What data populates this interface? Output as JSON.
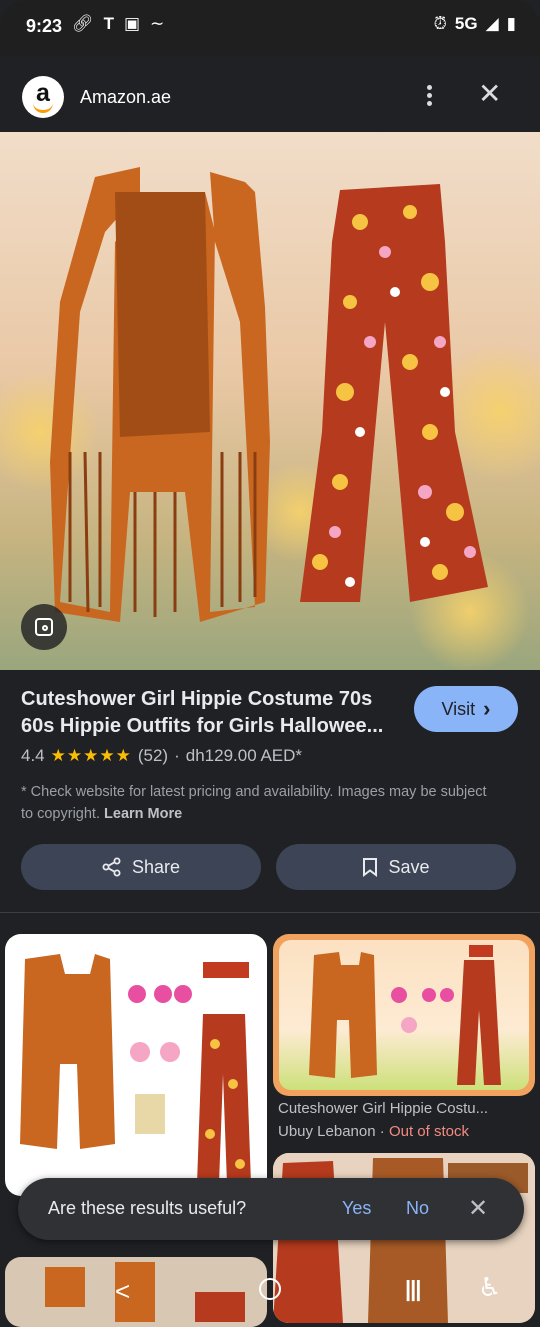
{
  "status_bar": {
    "time": "9:23",
    "network": "5G",
    "left_icons": [
      "link-icon",
      "tmobile-icon",
      "message-icon",
      "signature-icon"
    ],
    "right_icons": [
      "alarm-icon",
      "signal-icon",
      "battery-icon"
    ]
  },
  "header": {
    "site_name": "Amazon.ae",
    "logo_letter": "a",
    "menu_icon": "more-vert-icon",
    "close_icon": "close-icon",
    "close_glyph": "✕"
  },
  "product": {
    "title": "Cuteshower Girl Hippie Costume 70s 60s Hippie Outfits for Girls Halloween...",
    "title_line1": "Cuteshower Girl Hippie Costume 70s",
    "title_line2": "60s Hippie Outfits for Girls Hallowee...",
    "rating": "4.4",
    "rating_value": 4.4,
    "stars": "★★★★★",
    "review_count": "(52)",
    "separator": "·",
    "price": "dh129.00 AED*",
    "visit_label": "Visit",
    "visit_chevron": "›",
    "disclaimer": "* Check website for latest pricing and availability. Images may be subject to copyright.",
    "learn_more": "Learn More"
  },
  "actions": {
    "share_label": "Share",
    "save_label": "Save"
  },
  "related": [
    {
      "title": "Cuteshower Girl Hippie Costu...",
      "source": "Ubuy Lebanon",
      "separator": " · ",
      "availability": "Out of stock"
    }
  ],
  "feedback": {
    "question": "Are these results useful?",
    "yes": "Yes",
    "no": "No",
    "close_glyph": "✕"
  },
  "colors": {
    "background": "#202124",
    "accent": "#8ab4f8",
    "button": "#3c4455",
    "star": "#fbbc04",
    "out_of_stock": "#f28b82"
  }
}
